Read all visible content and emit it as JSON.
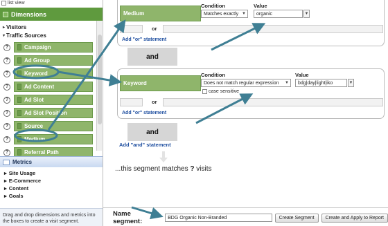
{
  "left": {
    "list_view": "list view",
    "dimensions_title": "Dimensions",
    "tree": [
      {
        "label": "Visitors",
        "expanded": false
      },
      {
        "label": "Traffic Sources",
        "expanded": true
      }
    ],
    "dimension_items": [
      "Campaign",
      "Ad Group",
      "Keyword",
      "Ad Content",
      "Ad Slot",
      "Ad Slot Position",
      "Source",
      "Medium",
      "Referral Path"
    ],
    "metrics_title": "Metrics",
    "metrics_items": [
      "Site Usage",
      "E-Commerce",
      "Content",
      "Goals"
    ],
    "help_text": "Drag and drop dimensions and metrics into the boxes to create a visit segment."
  },
  "condition1": {
    "dimension": "Medium",
    "condition_label": "Condition",
    "value_label": "Value",
    "condition": "Matches exactly",
    "value": "organic",
    "or_label": "or",
    "add_or": "Add \"or\" statement"
  },
  "and_label_1": "and",
  "condition2": {
    "dimension": "Keyword",
    "condition_label": "Condition",
    "value_label": "Value",
    "condition": "Does not match regular expression",
    "value": "bdg|day|light|iko",
    "case_sensitive": "case sensitive",
    "or_label": "or",
    "add_or": "Add \"or\" statement"
  },
  "and_label_2": "and",
  "add_and": "Add \"and\" statement",
  "matches": {
    "prefix": "...this segment matches",
    "count": "?",
    "suffix": "visits"
  },
  "segment": {
    "label": "Name segment:",
    "name": "BDG Organic Non-Branded",
    "create_button": "Create Segment",
    "apply_button": "Create and Apply to Report"
  },
  "colors": {
    "green": "#8fb56b",
    "dark_green": "#5f9a3e",
    "arrow": "#3f7f94",
    "link": "#1f4fa0"
  }
}
